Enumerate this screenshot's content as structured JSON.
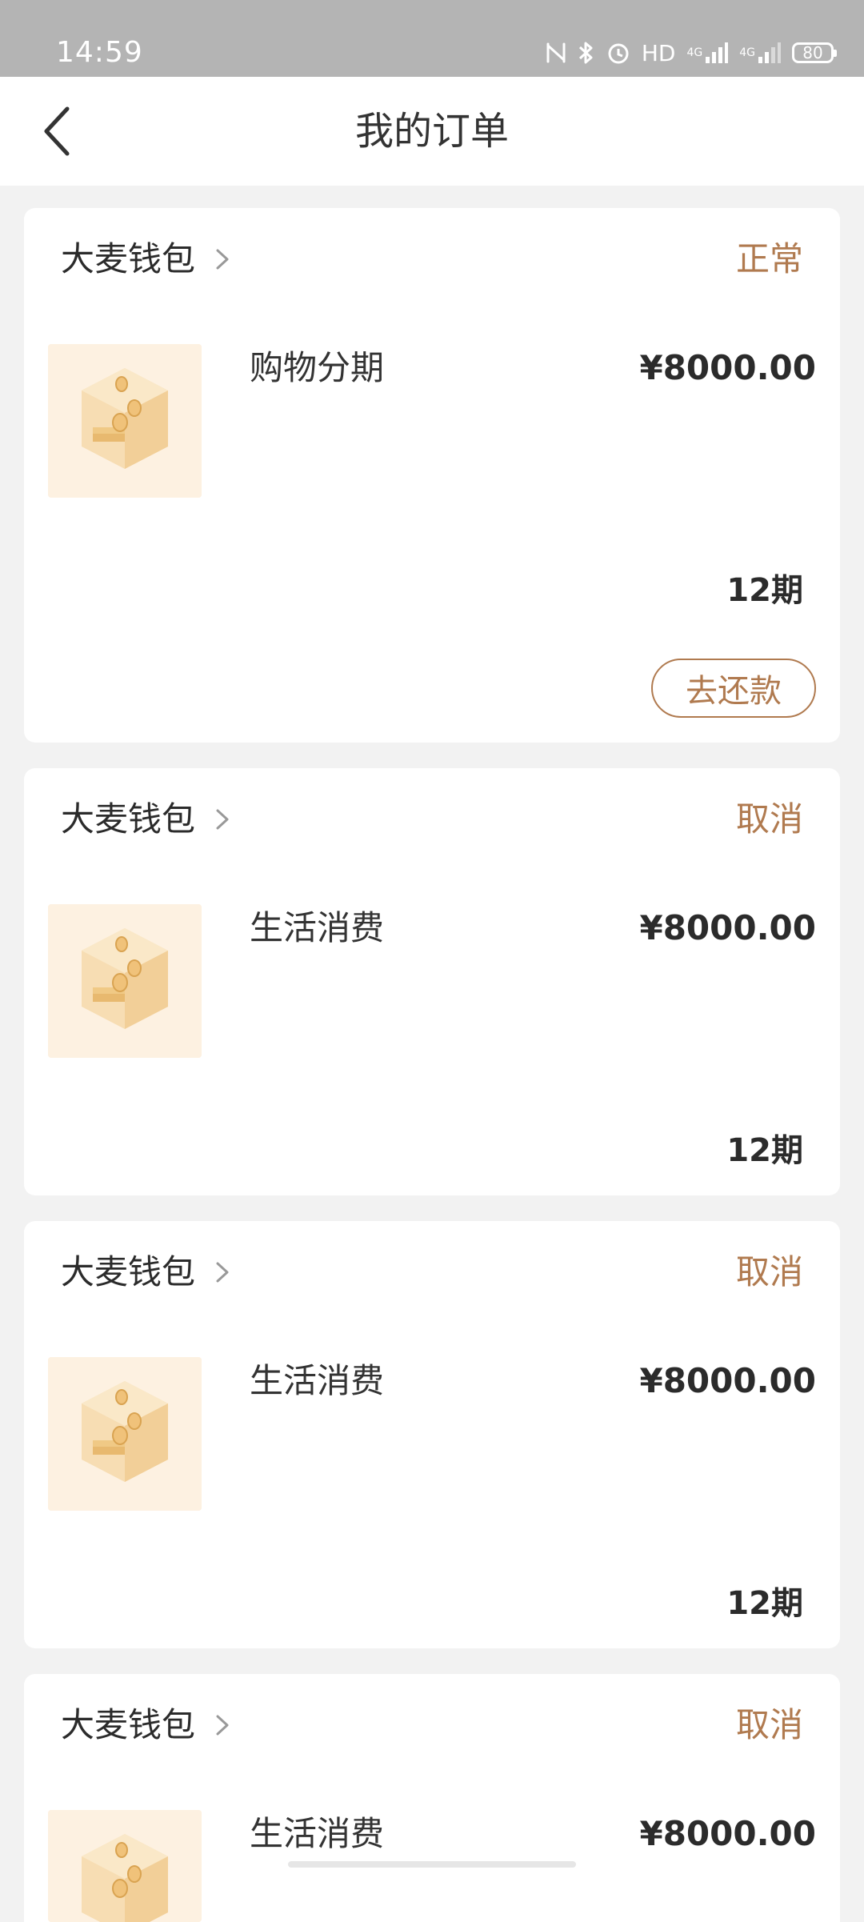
{
  "status_bar": {
    "time": "14:59",
    "hd": "HD",
    "network1": "4G",
    "network2": "4G",
    "battery": "80"
  },
  "header": {
    "title": "我的订单"
  },
  "orders": [
    {
      "shop": "大麦钱包",
      "status": "正常",
      "item": "购物分期",
      "price": "¥8000.00",
      "periods": "12期",
      "action": "去还款"
    },
    {
      "shop": "大麦钱包",
      "status": "取消",
      "item": "生活消费",
      "price": "¥8000.00",
      "periods": "12期"
    },
    {
      "shop": "大麦钱包",
      "status": "取消",
      "item": "生活消费",
      "price": "¥8000.00",
      "periods": "12期"
    },
    {
      "shop": "大麦钱包",
      "status": "取消",
      "item": "生活消费",
      "price": "¥8000.00"
    }
  ],
  "colors": {
    "accent": "#b07a4f",
    "status_bar": "#b4b4b4",
    "background": "#f2f2f2"
  }
}
